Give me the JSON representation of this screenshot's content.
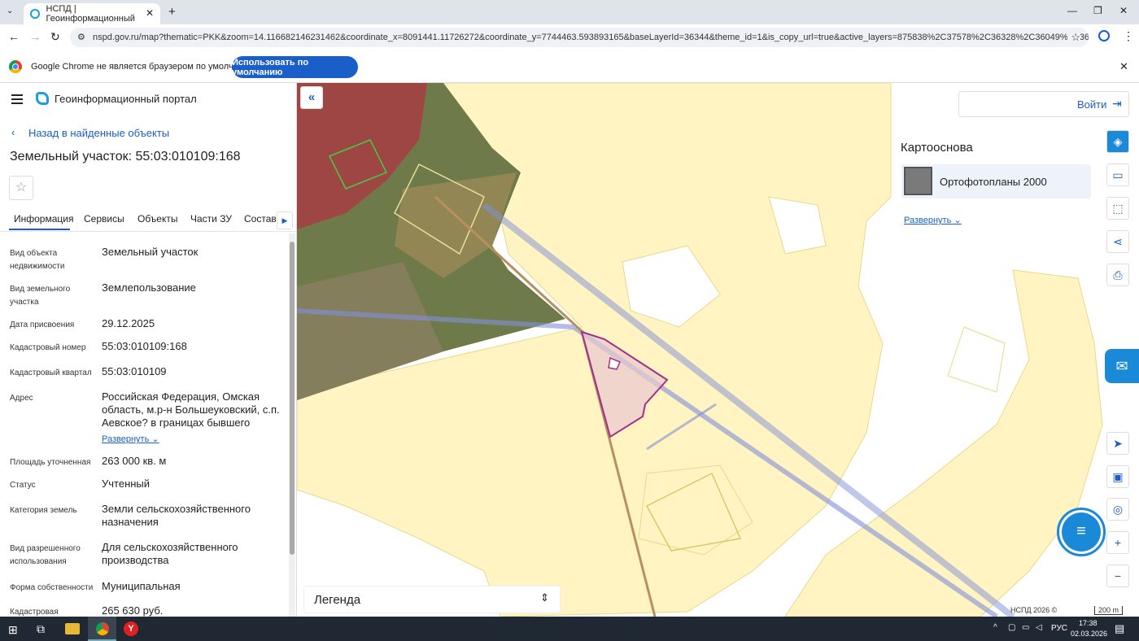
{
  "browser": {
    "tab_title": "НСПД | Геоинформационный",
    "url": "nspd.gov.ru/map?thematic=PKK&zoom=14.116682146231462&coordinate_x=8091441.11726272&coordinate_y=7744463.593893165&baseLayerId=36344&theme_id=1&is_copy_url=true&active_layers=875838%2C37578%2C36328%2C36049%2C36048&selected...",
    "infobar_text": "Google Chrome не является браузером по умолчанию.",
    "infobar_button": "Использовать по умолчанию"
  },
  "portal": {
    "title": "Геоинформационный портал",
    "back_link": "Назад в найденные объекты",
    "object_title": "Земельный участок: 55:03:010109:168"
  },
  "tabs": [
    "Информация",
    "Сервисы",
    "Объекты",
    "Части ЗУ",
    "Состав"
  ],
  "fields": [
    {
      "label": "Вид объекта недвижимости",
      "value": "Земельный участок"
    },
    {
      "label": "Вид земельного участка",
      "value": "Землепользование"
    },
    {
      "label": "Дата присвоения",
      "value": "29.12.2025"
    },
    {
      "label": "Кадастровый номер",
      "value": "55:03:010109:168"
    },
    {
      "label": "Кадастровый квартал",
      "value": "55:03:010109"
    },
    {
      "label": "Адрес",
      "value": "Российская Федерация, Омская область, м.р-н Большеуковский, с.п. Аевское? в границах бывшего"
    },
    {
      "label": "Площадь уточненная",
      "value": "263 000 кв. м"
    },
    {
      "label": "Статус",
      "value": "Учтенный"
    },
    {
      "label": "Категория земель",
      "value": "Земли сельскохозяйственного назначения"
    },
    {
      "label": "Вид разрешенного использования",
      "value": "Для сельскохозяйственного производства"
    },
    {
      "label": "Форма собственности",
      "value": "Муниципальная"
    },
    {
      "label": "Кадастровая",
      "value": "265 630 руб."
    }
  ],
  "expand_link": "Развернуть",
  "map": {
    "login": "Войти",
    "basemap_title": "Картооснова",
    "basemap_item": "Ортофотопланы 2000",
    "basemap_expand": "Развернуть",
    "legend": "Легенда",
    "attribution": "НСПД 2026 ©",
    "scale": "200 m"
  },
  "taskbar": {
    "lang": "РУС",
    "time": "17:38",
    "date": "02.03.2026"
  },
  "colors": {
    "accent": "#1a5ec8",
    "map_yellow": "#fff4c2",
    "parcel": "#a0308a"
  }
}
